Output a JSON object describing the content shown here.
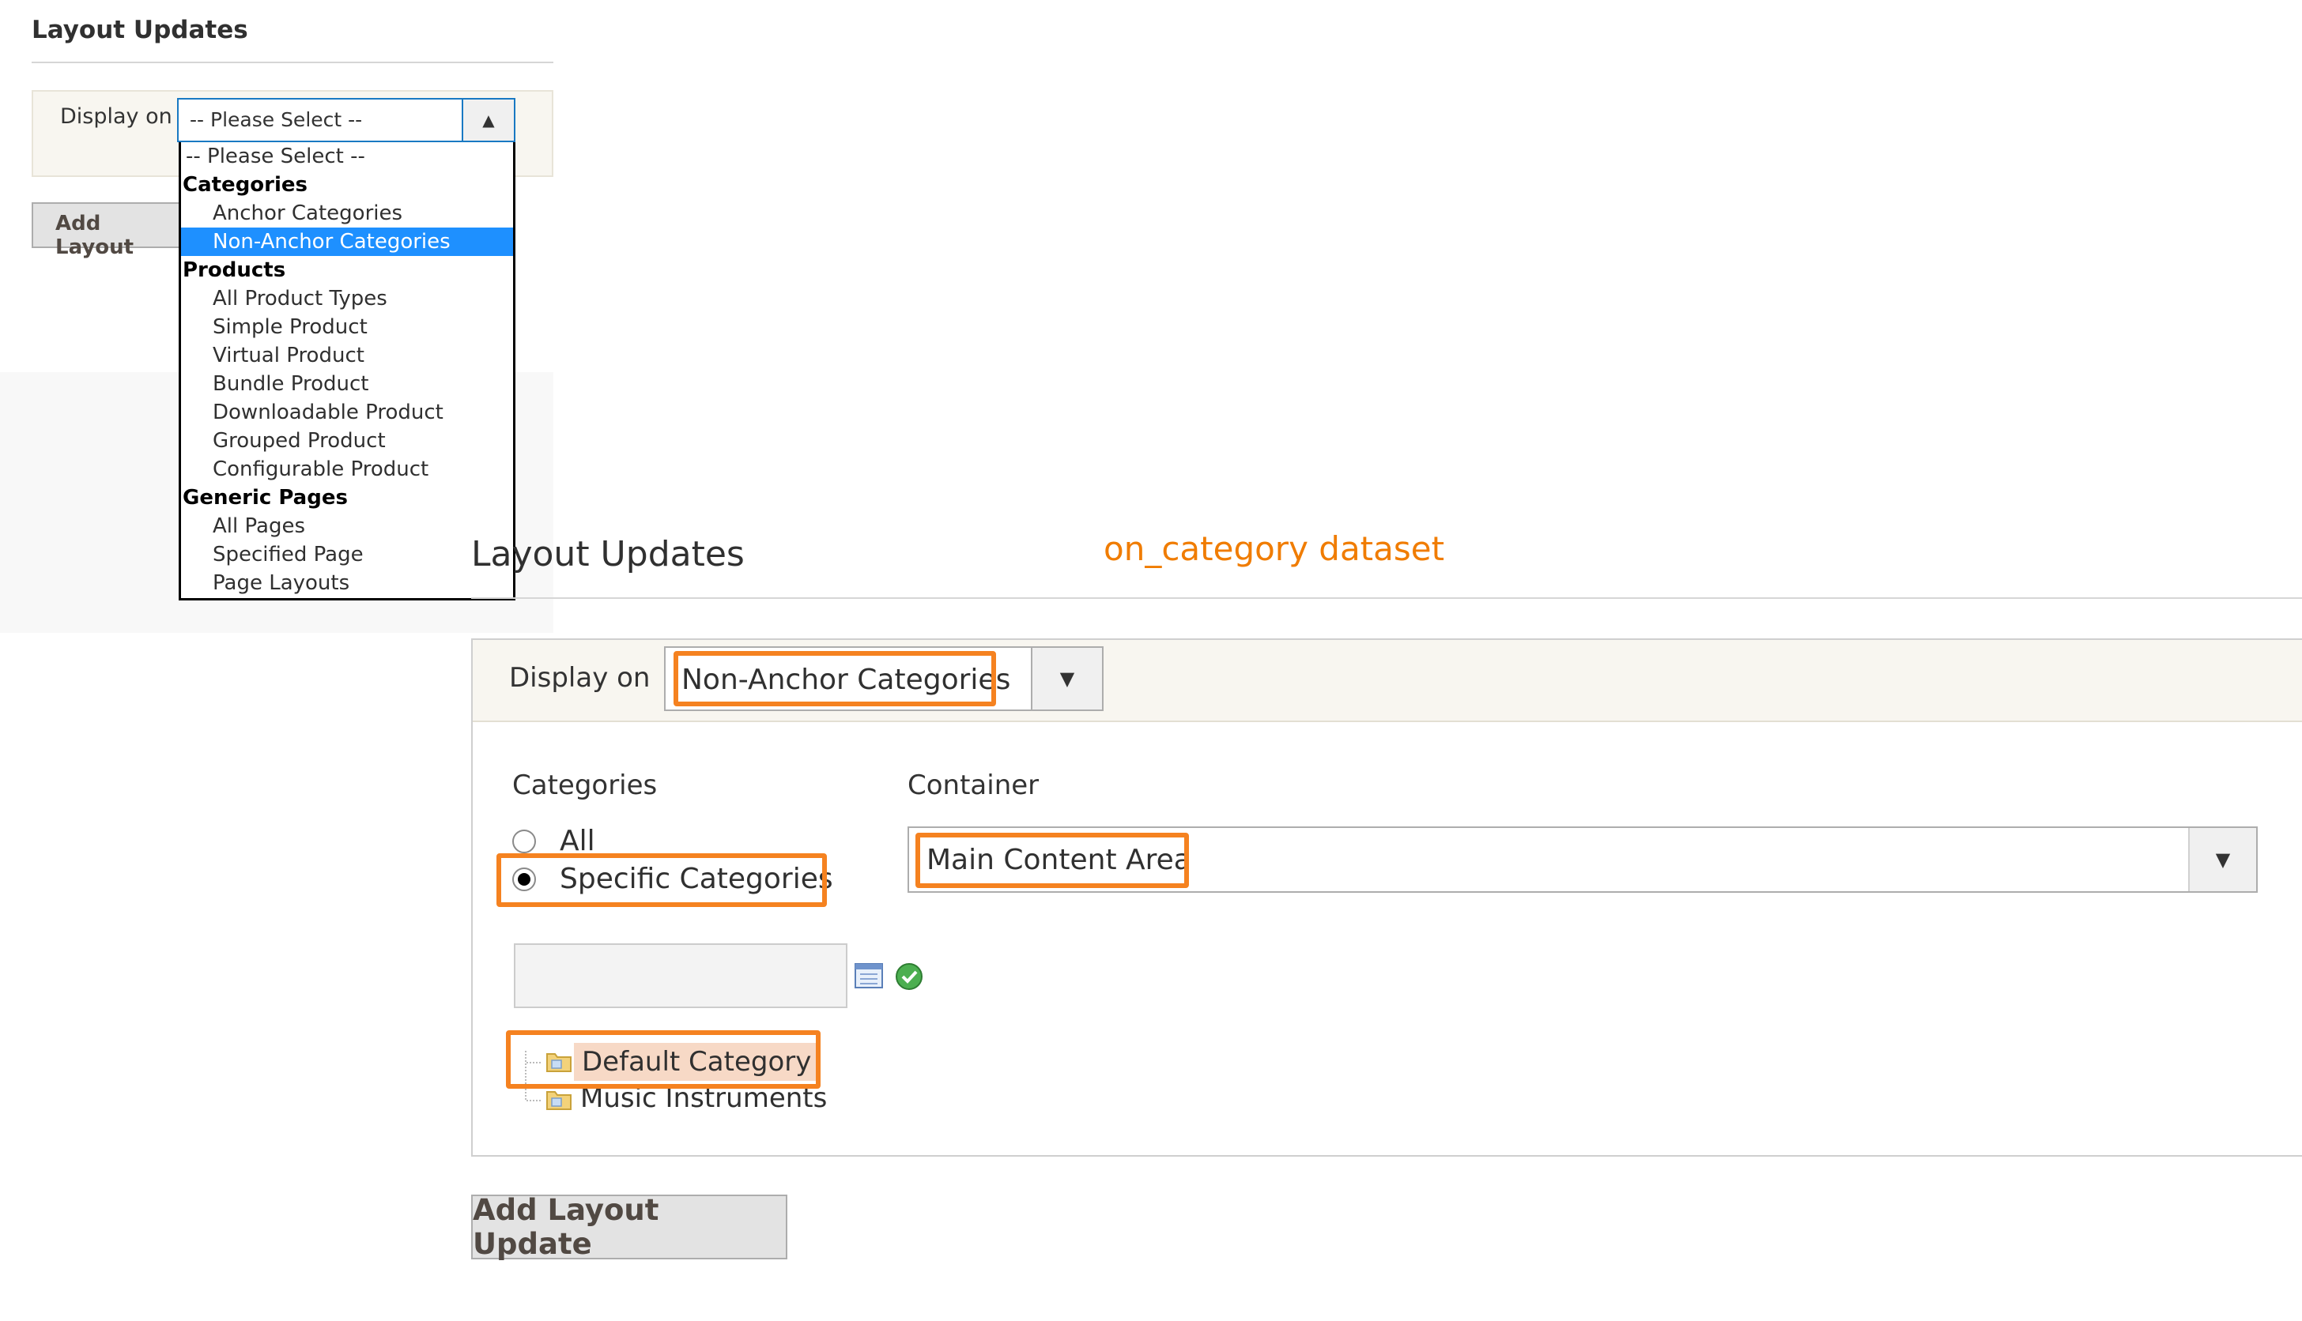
{
  "dropdown_screen": {
    "title": "Layout Updates",
    "display_on_label": "Display on",
    "select_value": "-- Please Select --",
    "add_button_label": "Add Layout",
    "options": [
      {
        "label": "-- Please Select --",
        "type": "option"
      },
      {
        "label": "Categories",
        "type": "group"
      },
      {
        "label": "Anchor Categories",
        "type": "option"
      },
      {
        "label": "Non-Anchor Categories",
        "type": "option",
        "selected": true
      },
      {
        "label": "Products",
        "type": "group"
      },
      {
        "label": "All Product Types",
        "type": "option"
      },
      {
        "label": "Simple Product",
        "type": "option"
      },
      {
        "label": "Virtual Product",
        "type": "option"
      },
      {
        "label": "Bundle Product",
        "type": "option"
      },
      {
        "label": "Downloadable Product",
        "type": "option"
      },
      {
        "label": "Grouped Product",
        "type": "option"
      },
      {
        "label": "Configurable Product",
        "type": "option"
      },
      {
        "label": "Generic Pages",
        "type": "group"
      },
      {
        "label": "All Pages",
        "type": "option"
      },
      {
        "label": "Specified Page",
        "type": "option"
      },
      {
        "label": "Page Layouts",
        "type": "option"
      }
    ]
  },
  "main": {
    "title": "Layout Updates",
    "annotation": "on_category dataset",
    "display_on_label": "Display on",
    "display_on_value": "Non-Anchor Categories",
    "categories_label": "Categories",
    "container_label": "Container",
    "radio_all_label": "All",
    "radio_specific_label": "Specific Categories",
    "container_value": "Main Content Area",
    "tree": {
      "root": "Default Category",
      "child": "Music Instruments"
    },
    "add_button_label": "Add Layout Update"
  },
  "colors": {
    "highlight": "#f58220",
    "selected_option": "#1e90ff",
    "annotation": "#f07c00"
  }
}
